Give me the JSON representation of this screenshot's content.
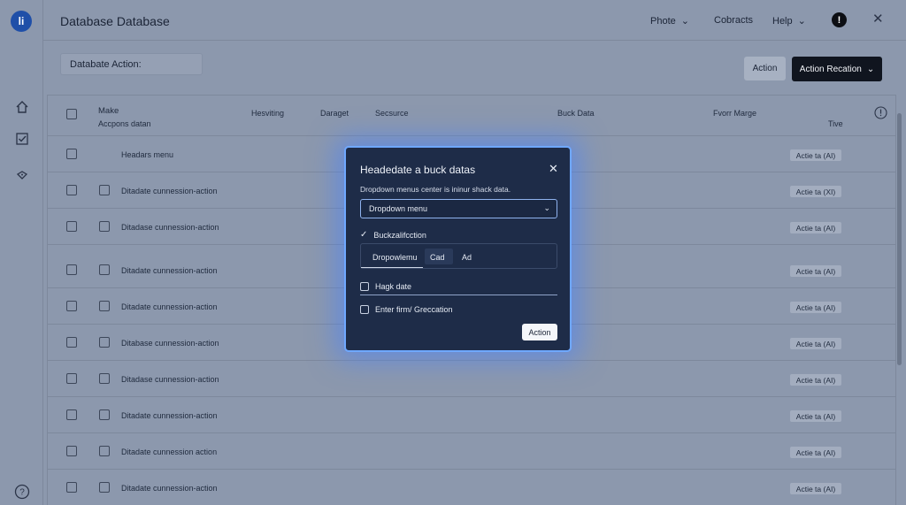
{
  "header": {
    "logo": "li",
    "title": "Database  Database",
    "nav": [
      {
        "label": "Phote",
        "has_chevron": true
      },
      {
        "label": "Cobracts",
        "has_chevron": false
      },
      {
        "label": "Help",
        "has_chevron": true
      }
    ]
  },
  "toolbar": {
    "section_label": "Databate Action:",
    "action_label": "Action",
    "action_recation_label": "Action Recation"
  },
  "table": {
    "columns": {
      "make": "Make",
      "make_sub": "Accpons datan",
      "hesviting": "Hesviting",
      "daraget": "Daraget",
      "secsurce": "Secsurce",
      "buck_data": "Buck Data",
      "fvorr_marge": "Fvorr Marge",
      "tive": "Tive"
    },
    "rows": [
      {
        "label": "Headars menu",
        "badge": "Actie ta (AI)",
        "has_inner_checkbox": false
      },
      {
        "label": "Ditadate cunnession-action",
        "badge": "Actie ta (XI)",
        "has_inner_checkbox": true
      },
      {
        "label": "Ditadase cunnession-action",
        "badge": "Actie ta (AI)",
        "has_inner_checkbox": true
      },
      {
        "label": "Ditadate cunnession-action",
        "badge": "Actie ta (AI)",
        "has_inner_checkbox": true
      },
      {
        "label": "Ditadate cunnession-action",
        "badge": "Actie ta (AI)",
        "has_inner_checkbox": true
      },
      {
        "label": "Ditabase cunnession-action",
        "badge": "Actie ta (AI)",
        "has_inner_checkbox": true
      },
      {
        "label": "Ditadase cunnession-action",
        "badge": "Actie ta (AI)",
        "has_inner_checkbox": true
      },
      {
        "label": "Ditadate cunnession-action",
        "badge": "Actie ta (AI)",
        "has_inner_checkbox": true
      },
      {
        "label": "Ditadate cunnession action",
        "badge": "Actie ta (AI)",
        "has_inner_checkbox": true
      },
      {
        "label": "Ditadate cunnession-action",
        "badge": "Actie ta (AI)",
        "has_inner_checkbox": true
      }
    ]
  },
  "modal": {
    "title": "Headedate a buck datas",
    "description": "Dropdown menus center is ininur shack data.",
    "select_value": "Dropdown menu",
    "checked_option": "Buckzalifcction",
    "tabs": [
      "Dropowlemu",
      "Cad",
      "Ad"
    ],
    "option_hagk": "Hagk date",
    "option_enter": "Enter firm/ Greccation",
    "action_label": "Action"
  },
  "colors": {
    "background": "#8c98ad",
    "modal_bg": "#1e2c48",
    "modal_glow": "#6fa8ff",
    "primary_button": "#10151f",
    "logo": "#1f4fa8"
  },
  "icons": [
    "home-icon",
    "checkbox-icon",
    "tag-icon",
    "help-icon",
    "alert-icon",
    "close-icon",
    "chevron-down-icon",
    "info-icon"
  ]
}
